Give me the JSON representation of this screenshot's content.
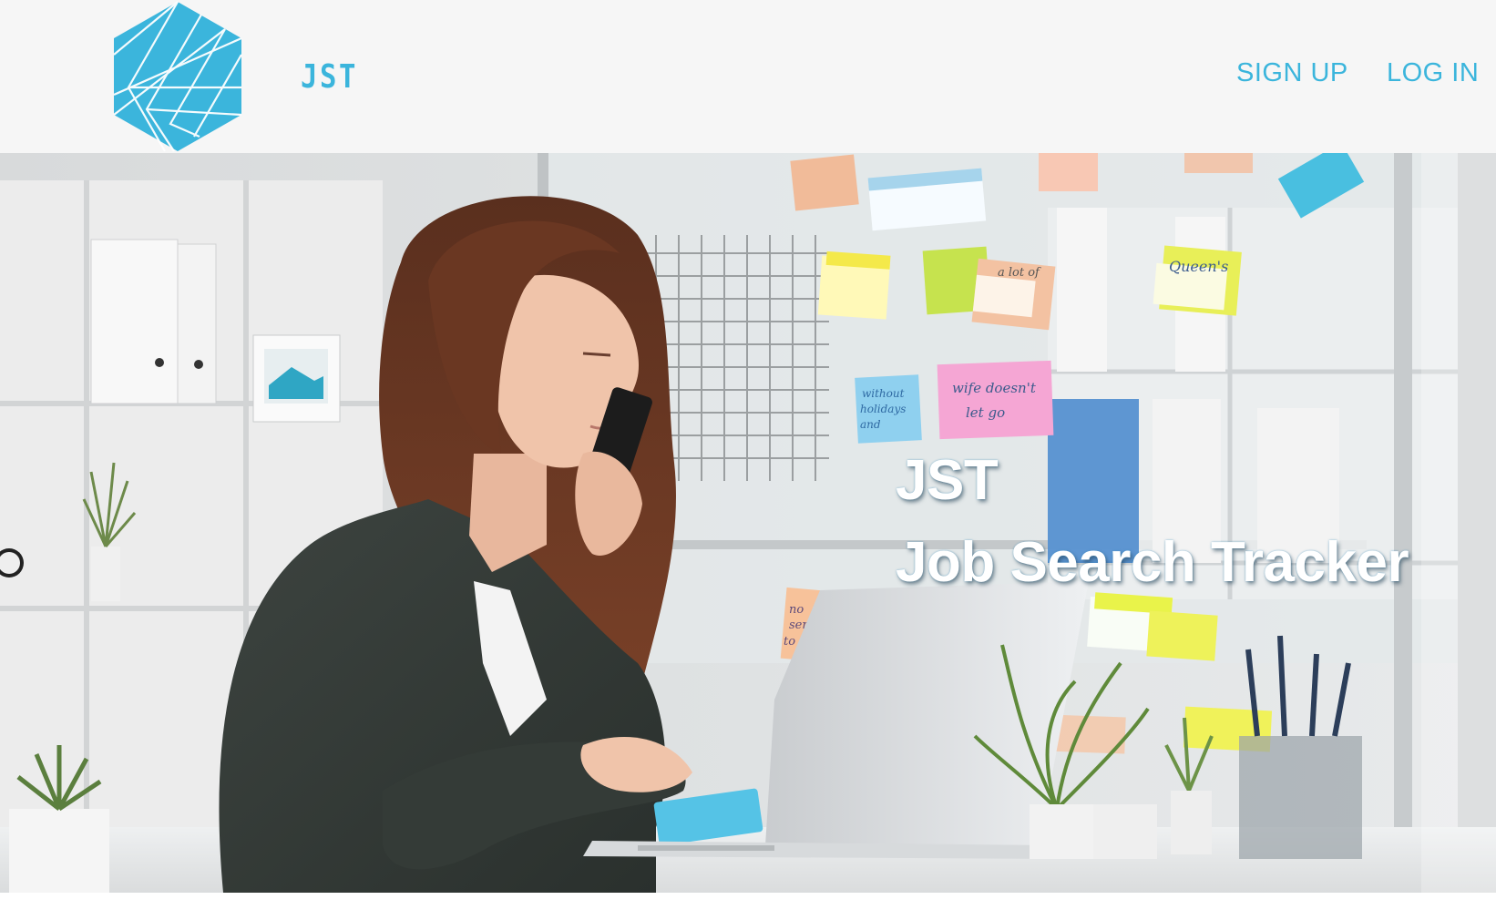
{
  "header": {
    "logo_icon": "hexagon-logo-icon",
    "brand": "JST",
    "nav": {
      "signup_label": "SIGN UP",
      "login_label": "LOG IN"
    }
  },
  "hero": {
    "image": "woman-on-phone-with-laptop-and-sticky-notes",
    "title_line1": "JST",
    "title_line2": "Job Search Tracker"
  },
  "colors": {
    "accent": "#3bb5dc",
    "header_bg": "#f6f6f6",
    "hero_text": "#ffffff"
  }
}
